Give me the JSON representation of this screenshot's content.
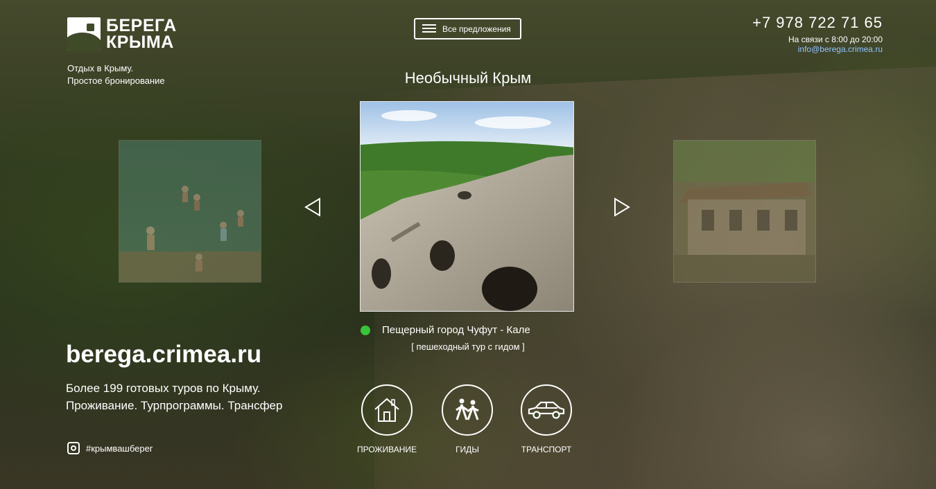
{
  "brand": {
    "name_line1": "БЕРЕГА",
    "name_line2": "КРЫМА",
    "tagline_line1": "Отдых в Крыму.",
    "tagline_line2": "Простое бронирование"
  },
  "header": {
    "menu_label": "Все предложения",
    "phone": "+7 978 722 71 65",
    "hours": "На связи с 8:00 до 20:00",
    "email": "info@berega.crimea.ru"
  },
  "slider": {
    "title": "Необычный Крым",
    "current_caption": "Пещерный город Чуфут - Кале",
    "current_subcaption": "[ пешеходный тур с гидом ]"
  },
  "promo": {
    "site": "berega.crimea.ru",
    "line1": "Более 199 готовых туров по Крыму.",
    "line2": "Проживание. Турпрограммы. Трансфер",
    "hashtag": "#крымвашберег"
  },
  "services": [
    {
      "label": "ПРОЖИВАНИЕ",
      "icon": "house-icon"
    },
    {
      "label": "ГИДЫ",
      "icon": "hikers-icon"
    },
    {
      "label": "ТРАНСПОРТ",
      "icon": "car-icon"
    }
  ],
  "colors": {
    "accent_green": "#3ac43a",
    "email_link": "#8fc3ff"
  }
}
